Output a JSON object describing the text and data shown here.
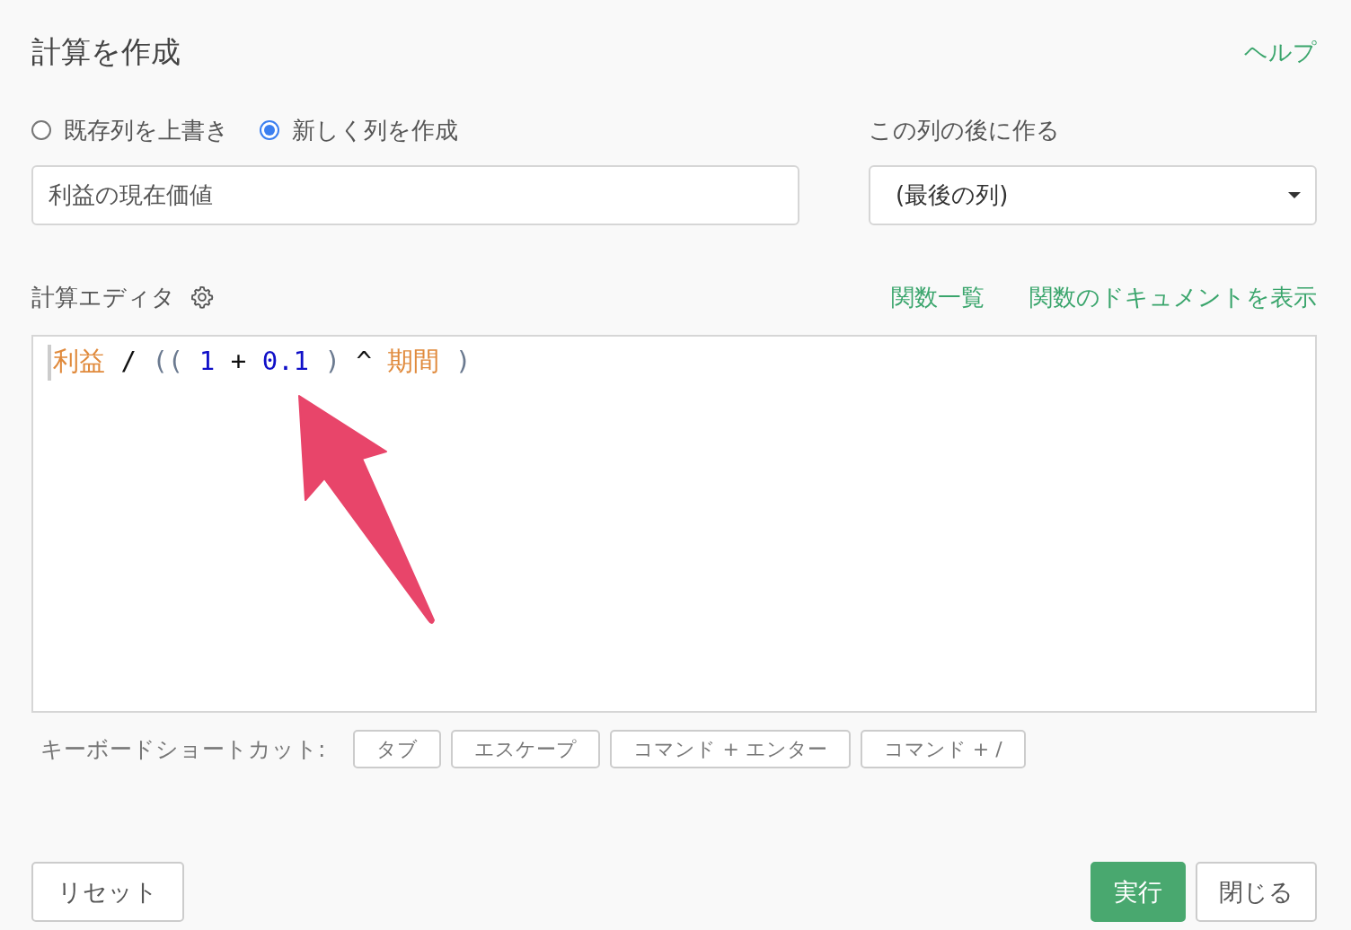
{
  "title": "計算を作成",
  "help_link": "ヘルプ",
  "mode_options": [
    {
      "label": "既存列を上書き",
      "selected": false
    },
    {
      "label": "新しく列を作成",
      "selected": true
    }
  ],
  "column_name": {
    "value": "利益の現在価値"
  },
  "position": {
    "label": "この列の後に作る",
    "value": "(最後の列)"
  },
  "editor": {
    "label": "計算エディタ",
    "links": [
      "関数一覧",
      "関数のドキュメントを表示"
    ],
    "tokens": [
      {
        "kind": "field",
        "text": "利益"
      },
      {
        "kind": "operator",
        "text": "/"
      },
      {
        "kind": "paren",
        "text": "(("
      },
      {
        "kind": "number",
        "text": "1"
      },
      {
        "kind": "operator",
        "text": "+"
      },
      {
        "kind": "number",
        "text": "0.1"
      },
      {
        "kind": "paren",
        "text": ")"
      },
      {
        "kind": "operator",
        "text": "^"
      },
      {
        "kind": "field",
        "text": "期間"
      },
      {
        "kind": "paren",
        "text": ")"
      }
    ]
  },
  "shortcuts": {
    "label": "キーボードショートカット:",
    "keys": [
      "タブ",
      "エスケープ",
      "コマンド + エンター",
      "コマンド + /"
    ]
  },
  "buttons": [
    {
      "label": "リセット",
      "kind": "secondary"
    },
    {
      "label": "実行",
      "kind": "primary"
    },
    {
      "label": "閉じる",
      "kind": "secondary"
    }
  ]
}
